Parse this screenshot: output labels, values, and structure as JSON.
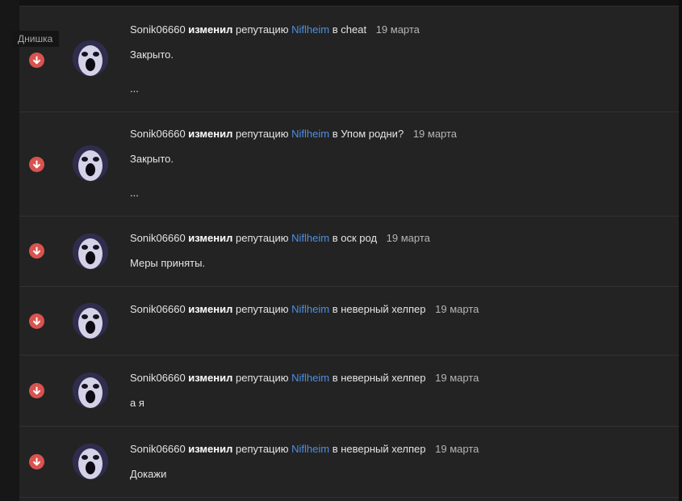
{
  "tooltip": "Днишка",
  "items": [
    {
      "user": "Sonik06660",
      "verb": "изменил",
      "action": "репутацию",
      "target": "Niflheim",
      "topic": "в cheat",
      "date": "19 марта",
      "text1": "Закрыто.",
      "text2": "..."
    },
    {
      "user": "Sonik06660",
      "verb": "изменил",
      "action": "репутацию",
      "target": "Niflheim",
      "topic": "в Упом родни?",
      "date": "19 марта",
      "text1": "Закрыто.",
      "text2": "..."
    },
    {
      "user": "Sonik06660",
      "verb": "изменил",
      "action": "репутацию",
      "target": "Niflheim",
      "topic": "в оск род",
      "date": "19 марта",
      "text1": "Меры приняты."
    },
    {
      "user": "Sonik06660",
      "verb": "изменил",
      "action": "репутацию",
      "target": "Niflheim",
      "topic": "в неверный хелпер",
      "date": "19 марта"
    },
    {
      "user": "Sonik06660",
      "verb": "изменил",
      "action": "репутацию",
      "target": "Niflheim",
      "topic": "в неверный хелпер",
      "date": "19 марта",
      "text1": "а я"
    },
    {
      "user": "Sonik06660",
      "verb": "изменил",
      "action": "репутацию",
      "target": "Niflheim",
      "topic": "в неверный хелпер",
      "date": "19 марта",
      "text1": "Докажи"
    }
  ],
  "icons": {
    "rep": "arrow-down-circle-icon"
  },
  "colors": {
    "background": "#232323",
    "link": "#4d8fe3",
    "negative": "#d9534f"
  }
}
